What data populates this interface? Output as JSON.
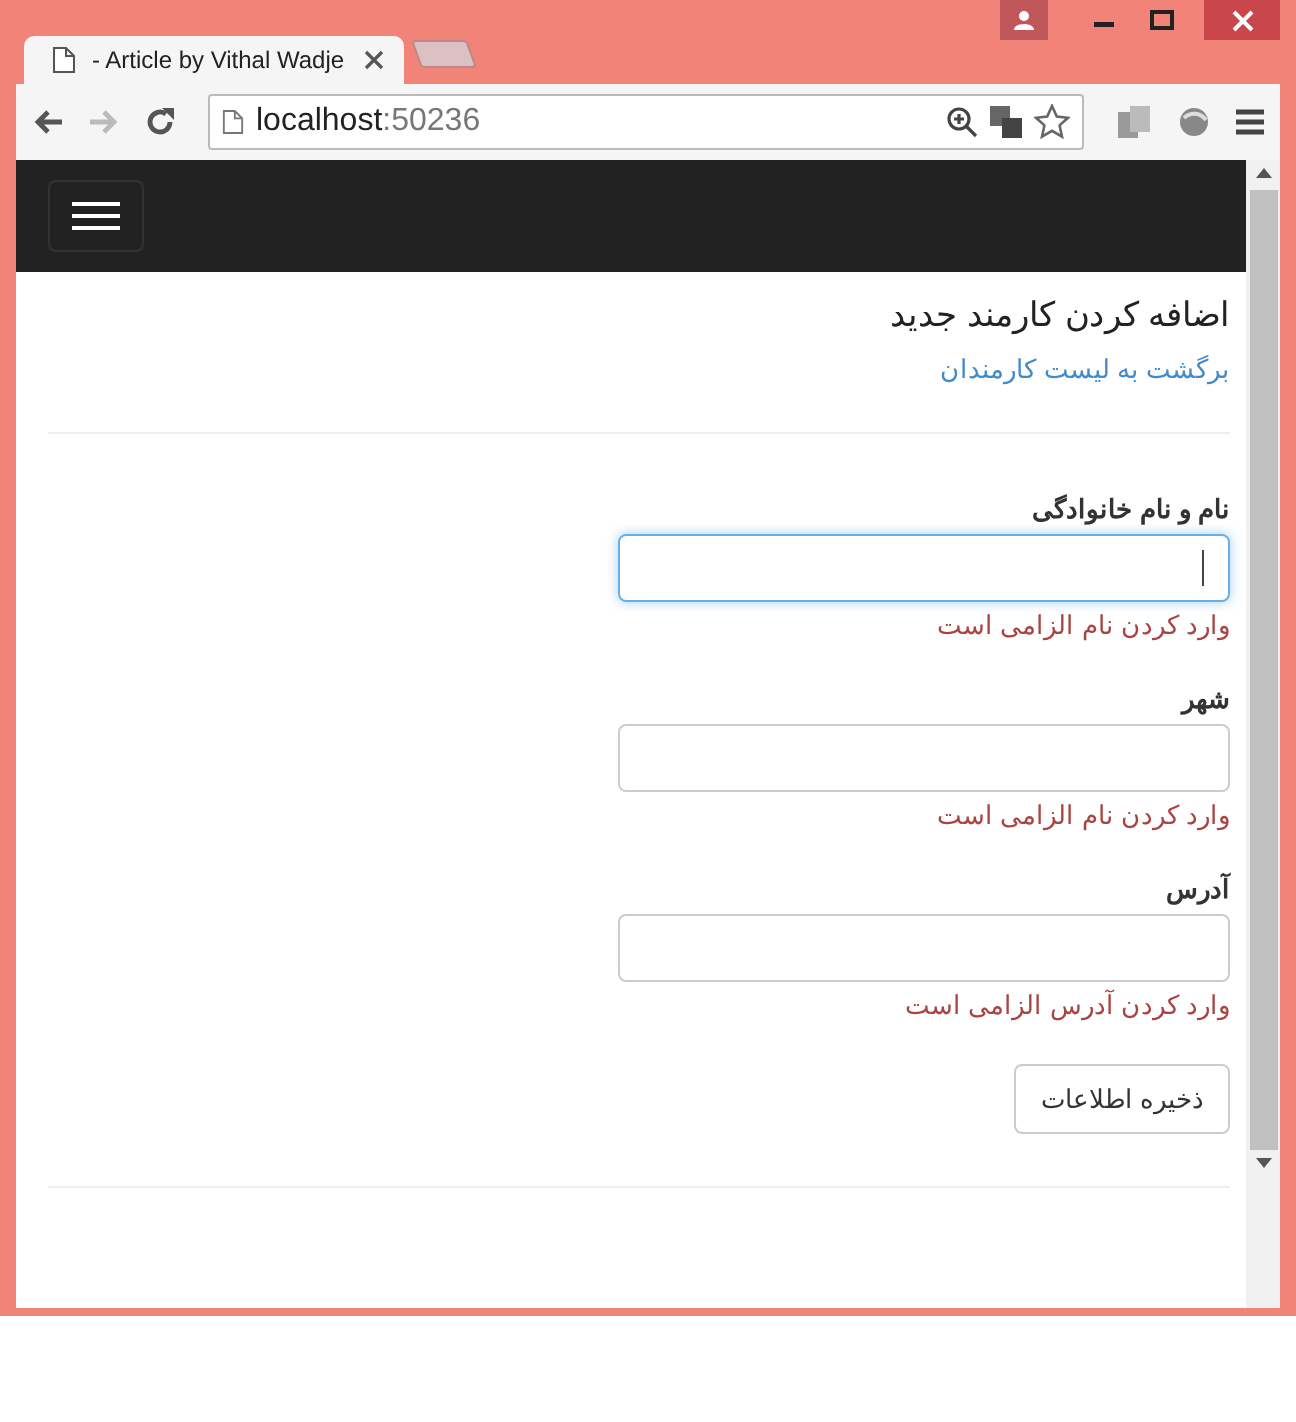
{
  "browser": {
    "tab_title": "- Article by Vithal Wadje",
    "url_host": "localhost",
    "url_port": ":50236"
  },
  "page": {
    "heading": "اضافه کردن کارمند جدید",
    "back_link": "برگشت به لیست کارمندان",
    "fields": [
      {
        "label": "نام و نام خانوادگی",
        "focused": true,
        "error": "وارد کردن نام الزامی است"
      },
      {
        "label": "شهر",
        "focused": false,
        "error": "وارد کردن نام الزامی است"
      },
      {
        "label": "آدرس",
        "focused": false,
        "error": "وارد کردن آدرس الزامی است"
      }
    ],
    "save_button": "ذخیره اطلاعات"
  }
}
